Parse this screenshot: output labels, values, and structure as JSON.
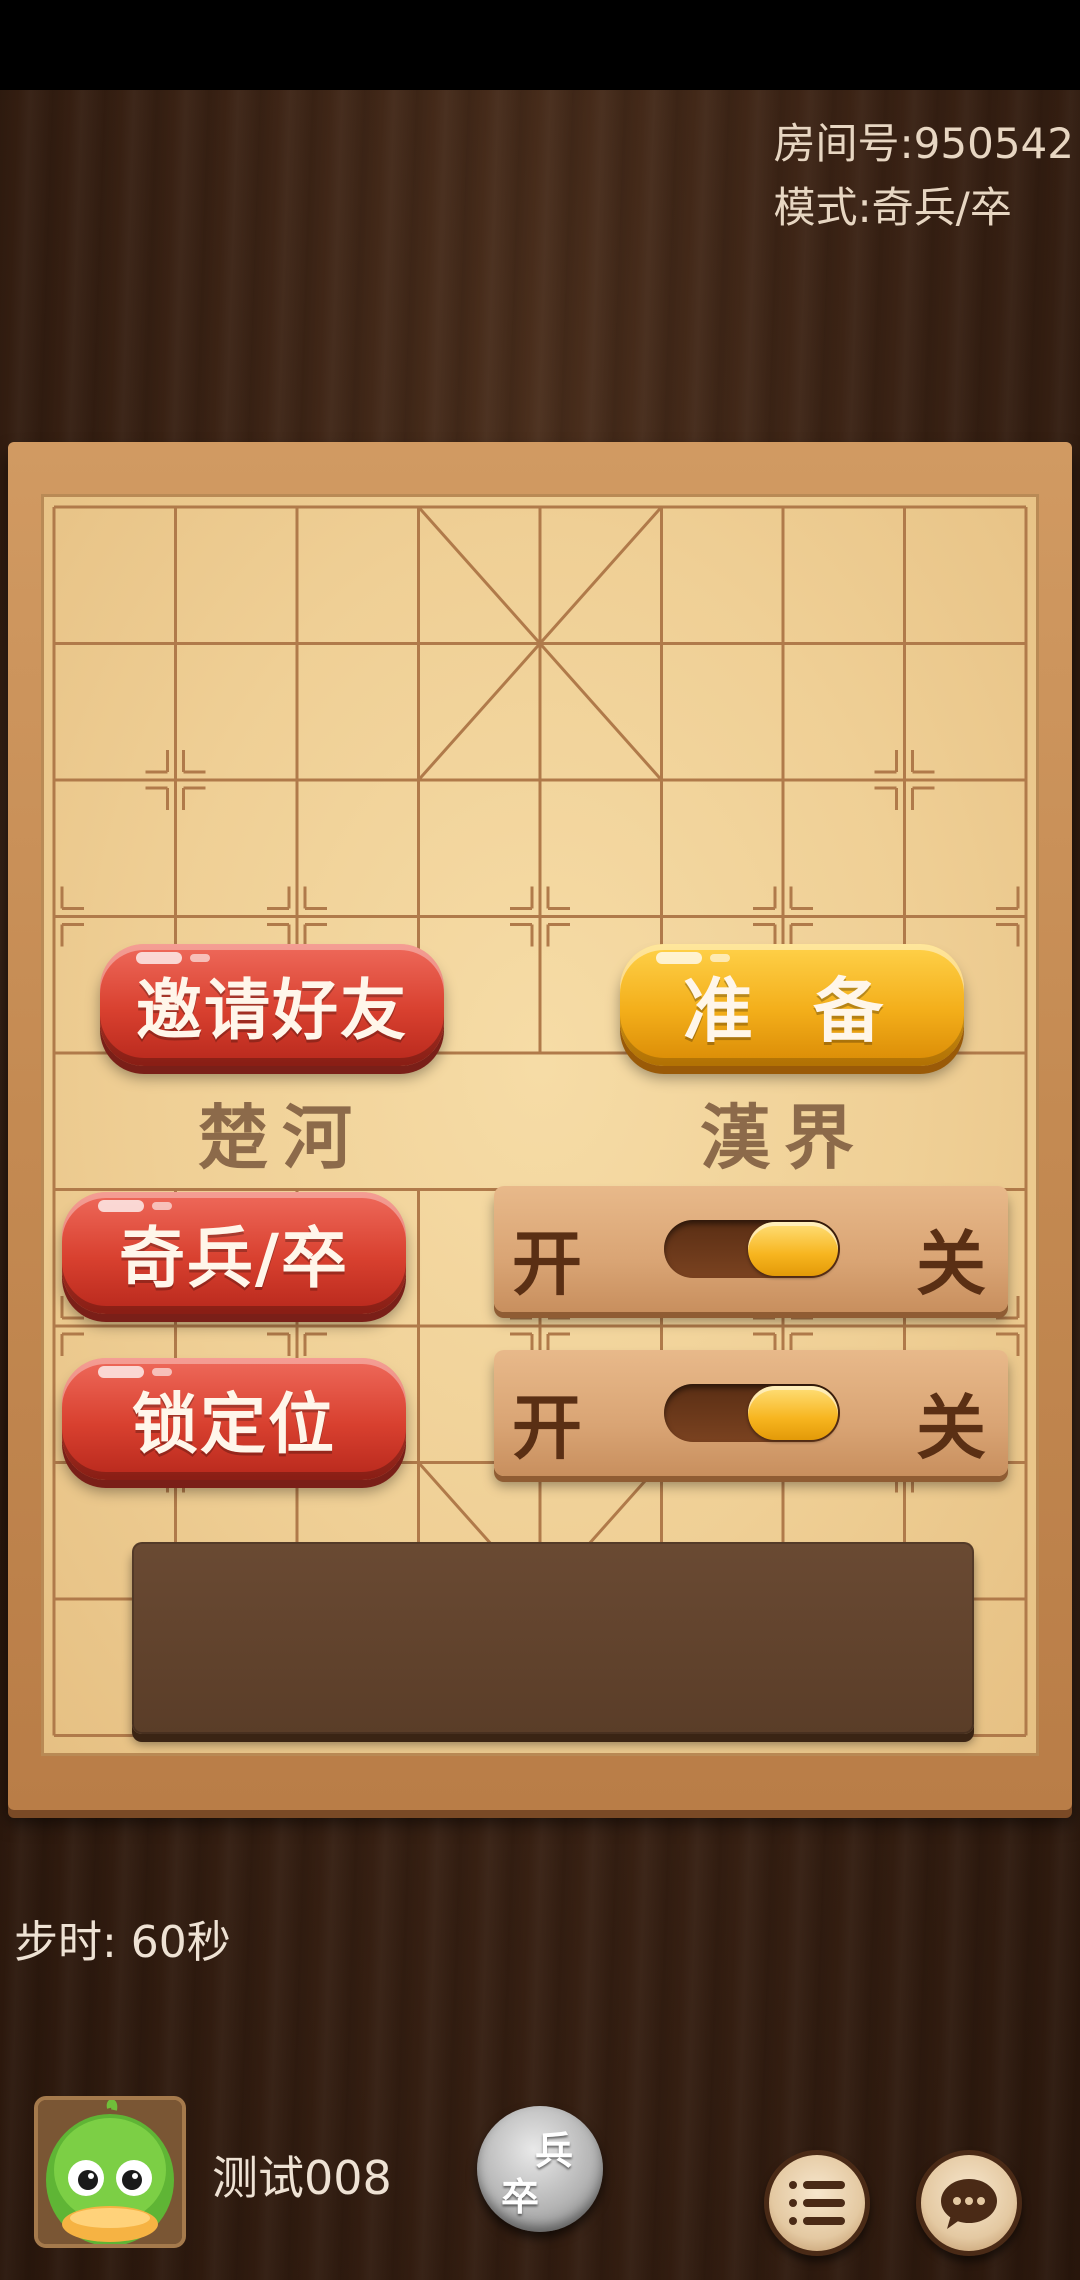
{
  "room": {
    "room_number": "房间号:950542",
    "mode": "模式:奇兵/卒"
  },
  "buttons": {
    "invite": "邀请好友",
    "ready": "准 备",
    "qibing": "奇兵/卒",
    "lock": "锁定位"
  },
  "board": {
    "river_left": "楚河",
    "river_right": "漢界"
  },
  "toggles": [
    {
      "on_label": "开",
      "off_label": "关",
      "state": "on"
    },
    {
      "on_label": "开",
      "off_label": "关",
      "state": "on"
    }
  ],
  "step_time": "步时: 60秒",
  "player": {
    "name": "测试008",
    "avatar_icon": "duck-avatar-icon"
  },
  "bottom": {
    "piece_top": "兵",
    "piece_bottom": "卒",
    "menu_icon": "menu-icon",
    "chat_icon": "chat-icon"
  }
}
